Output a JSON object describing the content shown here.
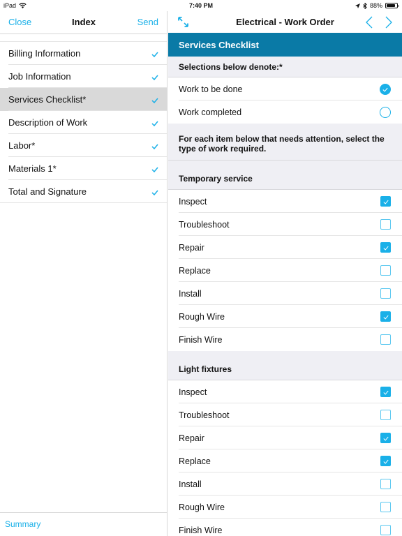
{
  "status_bar": {
    "device": "iPad",
    "time": "7:40 PM",
    "battery_percent": "88%",
    "battery_level": 0.88
  },
  "sidebar": {
    "close_label": "Close",
    "title": "Index",
    "send_label": "Send",
    "items": [
      {
        "label": "Billing Information",
        "complete": true,
        "selected": false
      },
      {
        "label": "Job Information",
        "complete": true,
        "selected": false
      },
      {
        "label": "Services Checklist*",
        "complete": true,
        "selected": true
      },
      {
        "label": "Description of Work",
        "complete": true,
        "selected": false
      },
      {
        "label": "Labor*",
        "complete": true,
        "selected": false
      },
      {
        "label": "Materials 1*",
        "complete": true,
        "selected": false
      },
      {
        "label": "Total and Signature",
        "complete": true,
        "selected": false
      }
    ],
    "footer_label": "Summary"
  },
  "main": {
    "title": "Electrical - Work Order",
    "section_title": "Services Checklist",
    "selections_header": "Selections below denote:*",
    "selection_options": [
      {
        "label": "Work to be done",
        "selected": true
      },
      {
        "label": "Work completed",
        "selected": false
      }
    ],
    "instructions": "For each item below that needs attention, select the type of work required.",
    "groups": [
      {
        "title": "Temporary service",
        "items": [
          {
            "label": "Inspect",
            "checked": true
          },
          {
            "label": "Troubleshoot",
            "checked": false
          },
          {
            "label": "Repair",
            "checked": true
          },
          {
            "label": "Replace",
            "checked": false
          },
          {
            "label": "Install",
            "checked": false
          },
          {
            "label": "Rough Wire",
            "checked": true
          },
          {
            "label": "Finish Wire",
            "checked": false
          }
        ]
      },
      {
        "title": "Light fixtures",
        "items": [
          {
            "label": "Inspect",
            "checked": true
          },
          {
            "label": "Troubleshoot",
            "checked": false
          },
          {
            "label": "Repair",
            "checked": true
          },
          {
            "label": "Replace",
            "checked": true
          },
          {
            "label": "Install",
            "checked": false
          },
          {
            "label": "Rough Wire",
            "checked": false
          },
          {
            "label": "Finish Wire",
            "checked": false
          }
        ]
      }
    ]
  },
  "colors": {
    "accent": "#1ab0e8",
    "banner": "#0a7aa6",
    "selected_row": "#d9d9d9",
    "group_bg": "#efeff4"
  }
}
